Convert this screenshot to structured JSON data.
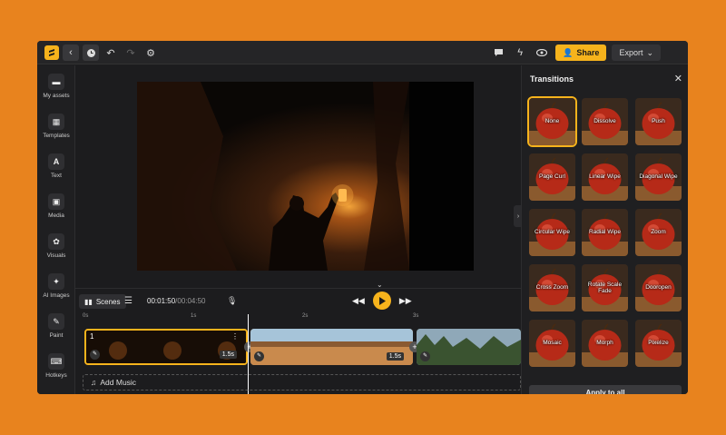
{
  "topbar": {
    "share_label": "Share",
    "export_label": "Export"
  },
  "sidebar": {
    "items": [
      {
        "label": "My assets",
        "icon": "folder-icon"
      },
      {
        "label": "Templates",
        "icon": "grid-icon"
      },
      {
        "label": "Text",
        "icon": "text-icon"
      },
      {
        "label": "Media",
        "icon": "image-icon"
      },
      {
        "label": "Visuals",
        "icon": "visuals-icon"
      },
      {
        "label": "AI Images",
        "icon": "magic-wand-icon"
      },
      {
        "label": "Paint",
        "icon": "brush-icon"
      },
      {
        "label": "Hotkeys",
        "icon": "keyboard-icon"
      }
    ]
  },
  "timeline": {
    "scenes_label": "Scenes",
    "current_time": "00:01:50",
    "total_time": "/00:04:50",
    "ruler": [
      "0s",
      "1s",
      "2s",
      "3s"
    ],
    "clips": [
      {
        "number": "1",
        "duration": "1.5s"
      },
      {
        "number": "",
        "duration": "1.5s"
      },
      {
        "number": "",
        "duration": ""
      }
    ],
    "add_music_label": "Add Music"
  },
  "transitions": {
    "title": "Transitions",
    "apply_label": "Apply to all",
    "items": [
      "None",
      "Dissolve",
      "Push",
      "Page Curl",
      "Linear Wipe",
      "Diagonal Wipe",
      "Circular Wipe",
      "Radial Wipe",
      "Zoom",
      "Cross Zoom",
      "Rotate Scale Fade",
      "Dooropen",
      "Mosaic",
      "Morph",
      "Pixelize"
    ],
    "selected": "None"
  },
  "colors": {
    "accent": "#f6b31c",
    "background": "#e8831e",
    "panel": "#1f1f21"
  }
}
